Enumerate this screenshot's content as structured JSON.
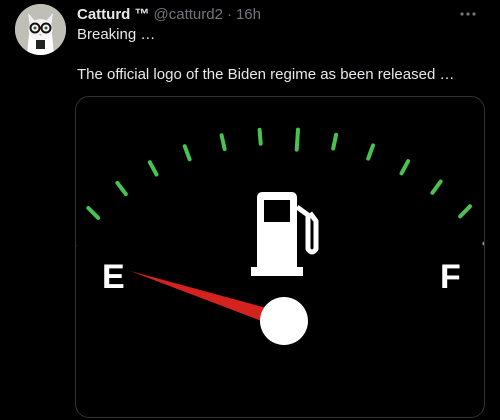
{
  "tweet": {
    "author_name": "Catturd ™",
    "handle": "@catturd2",
    "separator": "·",
    "time": "16h",
    "more_icon": "more-horizontal-icon",
    "line1": "Breaking …",
    "line2": "The official logo of the Biden regime as been released …"
  },
  "gauge": {
    "empty_label": "E",
    "full_label": "F",
    "fuel_level": 0.0,
    "needle_color": "#d4221f",
    "tick_color": "#49c34f",
    "icon": "fuel-pump-icon"
  },
  "colors": {
    "background": "#000000",
    "text": "#e7e9ea",
    "secondary": "#71767b",
    "border": "#2f3336"
  }
}
